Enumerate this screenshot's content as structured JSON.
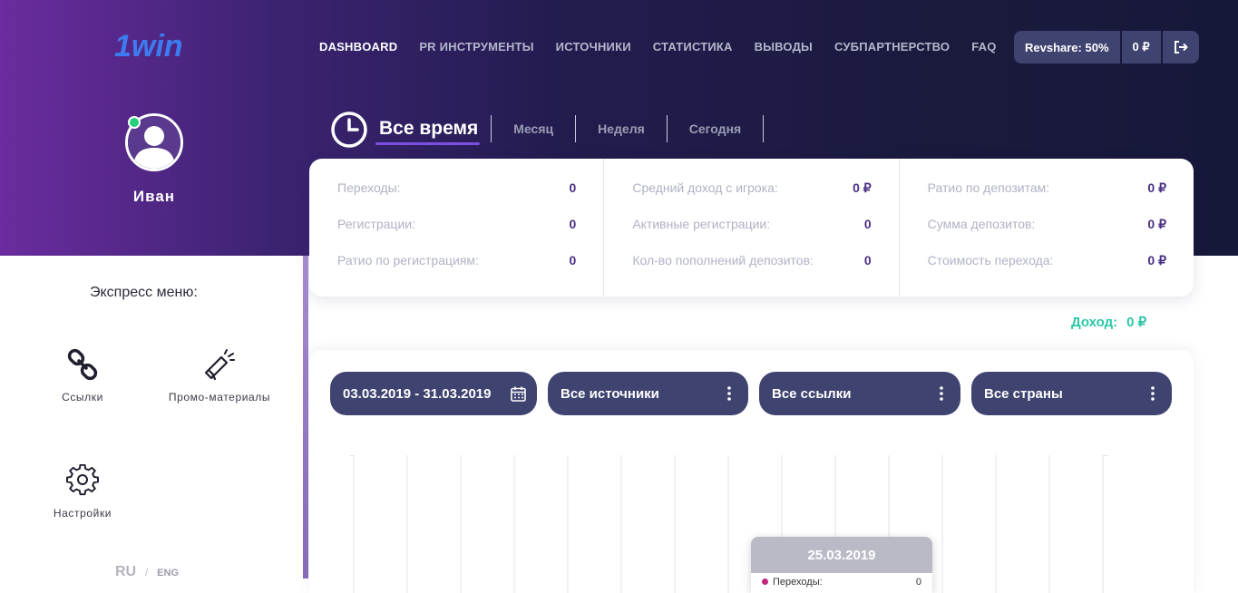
{
  "brand": {
    "logo_text": "1win"
  },
  "nav": {
    "items": [
      {
        "label": "DASHBOARD",
        "active": true
      },
      {
        "label": "PR ИНСТРУМЕНТЫ"
      },
      {
        "label": "ИСТОЧНИКИ"
      },
      {
        "label": "СТАТИСТИКА"
      },
      {
        "label": "ВЫВОДЫ"
      },
      {
        "label": "СУБПАРТНЕРСТВО"
      },
      {
        "label": "FAQ"
      }
    ],
    "revshare": "Revshare: 50%",
    "balance": "0 ₽",
    "logout_icon": "logout-icon"
  },
  "user": {
    "name": "Иван",
    "status_color": "#26d07c"
  },
  "period": {
    "tabs": [
      {
        "label": "Все время",
        "active": true
      },
      {
        "label": "Месяц"
      },
      {
        "label": "Неделя"
      },
      {
        "label": "Сегодня"
      }
    ]
  },
  "stats": {
    "columns": [
      [
        {
          "label": "Переходы:",
          "value": "0"
        },
        {
          "label": "Регистрации:",
          "value": "0"
        },
        {
          "label": "Ратио по регистрациям:",
          "value": "0"
        }
      ],
      [
        {
          "label": "Средний доход с игрока:",
          "value": "0 ₽"
        },
        {
          "label": "Активные регистрации:",
          "value": "0"
        },
        {
          "label": "Кол-во пополнений депозитов:",
          "value": "0"
        }
      ],
      [
        {
          "label": "Ратио по депозитам:",
          "value": "0 ₽"
        },
        {
          "label": "Сумма депозитов:",
          "value": "0 ₽"
        },
        {
          "label": "Стоимость перехода:",
          "value": "0 ₽"
        }
      ]
    ]
  },
  "income": {
    "label": "Доход:",
    "value": "0 ₽"
  },
  "express": {
    "title": "Экспресс меню:",
    "links": "Ссылки",
    "promo": "Промо-материалы",
    "settings": "Настройки"
  },
  "lang": {
    "ru": "RU",
    "sep": "/",
    "eng": "ENG"
  },
  "filters": {
    "date_range": "03.03.2019 - 31.03.2019",
    "sources": "Все источники",
    "links": "Все ссылки",
    "countries": "Все страны"
  },
  "tooltip": {
    "date": "25.03.2019",
    "row_label": "Переходы:",
    "row_value": "0",
    "row_color": "#c2277e"
  },
  "colors": {
    "accent": "#7b4fe0",
    "income": "#2bc7a8",
    "value": "#4a2f85",
    "button": "#3f4370"
  }
}
